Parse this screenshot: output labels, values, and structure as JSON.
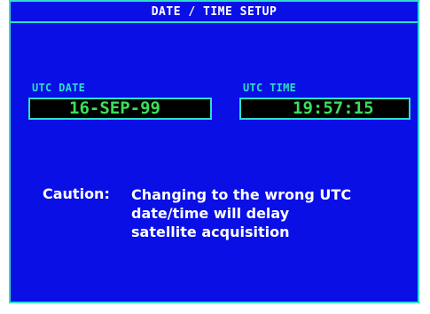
{
  "page": {
    "title": "DATE / TIME SETUP"
  },
  "utc_date": {
    "label": "UTC DATE",
    "value": "16-SEP-99"
  },
  "utc_time": {
    "label": "UTC TIME",
    "value": "19:57:15"
  },
  "caution": {
    "label": "Caution:",
    "lines": [
      "Changing to the wrong UTC",
      "date/time will delay",
      "satellite acquisition"
    ]
  },
  "colors": {
    "background": "#0a0fe6",
    "accent": "#2be0c8",
    "field_value": "#39e05a",
    "text": "#ffffff"
  }
}
